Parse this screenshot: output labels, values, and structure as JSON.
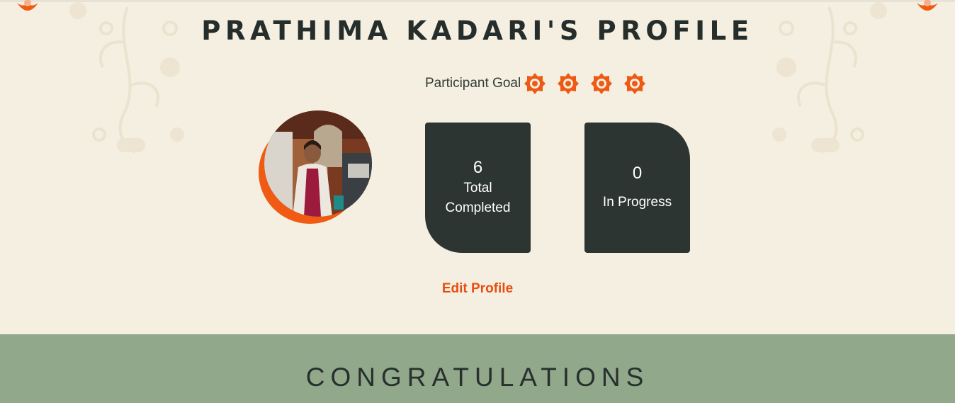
{
  "profile": {
    "title": "PRATHIMA KADARI'S PROFILE",
    "goal_label": "Participant Goal",
    "goal_icons": [
      "goal-flower-icon",
      "goal-flower-icon",
      "goal-flower-icon",
      "goal-flower-icon"
    ],
    "stats": {
      "completed_value": "6",
      "completed_label": "Total Completed",
      "in_progress_value": "0",
      "in_progress_label": "In Progress"
    },
    "edit_label": "Edit Profile"
  },
  "congrats": {
    "title": "CONGRATULATIONS"
  },
  "colors": {
    "background": "#f4efe1",
    "accent": "#e94e0f",
    "card": "#2c3532",
    "band": "#91a88b",
    "text": "#262e2c"
  }
}
